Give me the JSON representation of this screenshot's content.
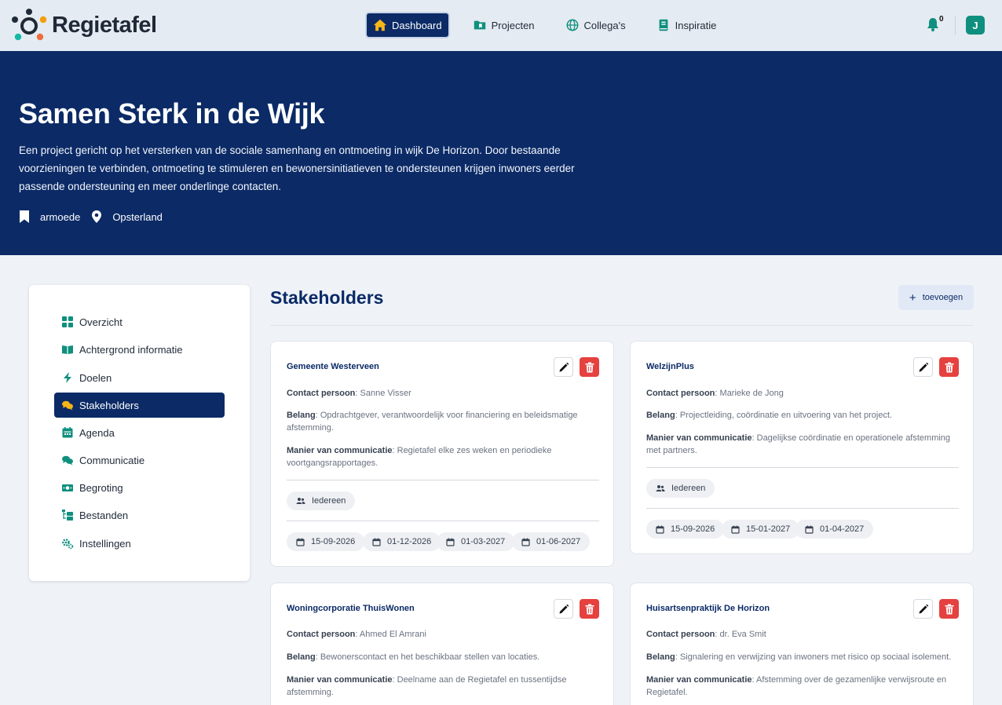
{
  "app": {
    "name": "Regietafel"
  },
  "nav": {
    "items": [
      {
        "label": "Dashboard",
        "icon": "home-icon",
        "active": true
      },
      {
        "label": "Projecten",
        "icon": "folder-icon",
        "active": false
      },
      {
        "label": "Collega's",
        "icon": "globe-icon",
        "active": false
      },
      {
        "label": "Inspiratie",
        "icon": "book-icon",
        "active": false
      }
    ],
    "notification_count": "0",
    "avatar_initial": "J"
  },
  "hero": {
    "title": "Samen Sterk in de Wijk",
    "description": "Een project gericht op het versterken van de sociale samenhang en ontmoeting in wijk De Horizon. Door bestaande voorzieningen te verbinden, ontmoeting te stimuleren en bewonersinitiatieven te ondersteunen krijgen inwoners eerder passende ondersteuning en meer onderlinge contacten.",
    "theme": "armoede",
    "location": "Opsterland"
  },
  "sidebar": {
    "items": [
      {
        "label": "Overzicht",
        "icon": "grid-icon"
      },
      {
        "label": "Achtergrond informatie",
        "icon": "open-book-icon"
      },
      {
        "label": "Doelen",
        "icon": "bolt-icon"
      },
      {
        "label": "Stakeholders",
        "icon": "chat-bubbles-icon",
        "active": true
      },
      {
        "label": "Agenda",
        "icon": "calendar-icon"
      },
      {
        "label": "Communicatie",
        "icon": "comments-icon"
      },
      {
        "label": "Begroting",
        "icon": "money-icon"
      },
      {
        "label": "Bestanden",
        "icon": "folder-tree-icon"
      },
      {
        "label": "Instellingen",
        "icon": "gears-icon"
      }
    ]
  },
  "main": {
    "title": "Stakeholders",
    "add_label": "toevoegen",
    "labels": {
      "contact": "Contact persoon",
      "belang": "Belang",
      "communicatie": "Manier van communicatie"
    },
    "cards": [
      {
        "name": "Gemeente Westerveen",
        "contact": "Sanne Visser",
        "belang": "Opdrachtgever, verantwoordelijk voor financiering en beleidsmatige afstemming.",
        "communicatie": "Regietafel elke zes weken en periodieke voortgangsrapportages.",
        "audience": "Iedereen",
        "dates": [
          "15-09-2026",
          "01-12-2026",
          "01-03-2027",
          "01-06-2027"
        ]
      },
      {
        "name": "WelzijnPlus",
        "contact": "Marieke de Jong",
        "belang": "Projectleiding, coördinatie en uitvoering van het project.",
        "communicatie": "Dagelijkse coördinatie en operationele afstemming met partners.",
        "audience": "Iedereen",
        "dates": [
          "15-09-2026",
          "15-01-2027",
          "01-04-2027"
        ]
      },
      {
        "name": "Woningcorporatie ThuisWonen",
        "contact": "Ahmed El Amrani",
        "belang": "Bewonerscontact en het beschikbaar stellen van locaties.",
        "communicatie": "Deelname aan de Regietafel en tussentijdse afstemming."
      },
      {
        "name": "Huisartsenpraktijk De Horizon",
        "contact": "dr. Eva Smit",
        "belang": "Signalering en verwijzing van inwoners met risico op sociaal isolement.",
        "communicatie": "Afstemming over de gezamenlijke verwijsroute en Regietafel."
      }
    ]
  },
  "colors": {
    "navy": "#0b2a66",
    "teal": "#0f8f7e",
    "danger": "#e5413f",
    "nav_bg": "#e5ebf2",
    "page_bg": "#eff3f8"
  }
}
